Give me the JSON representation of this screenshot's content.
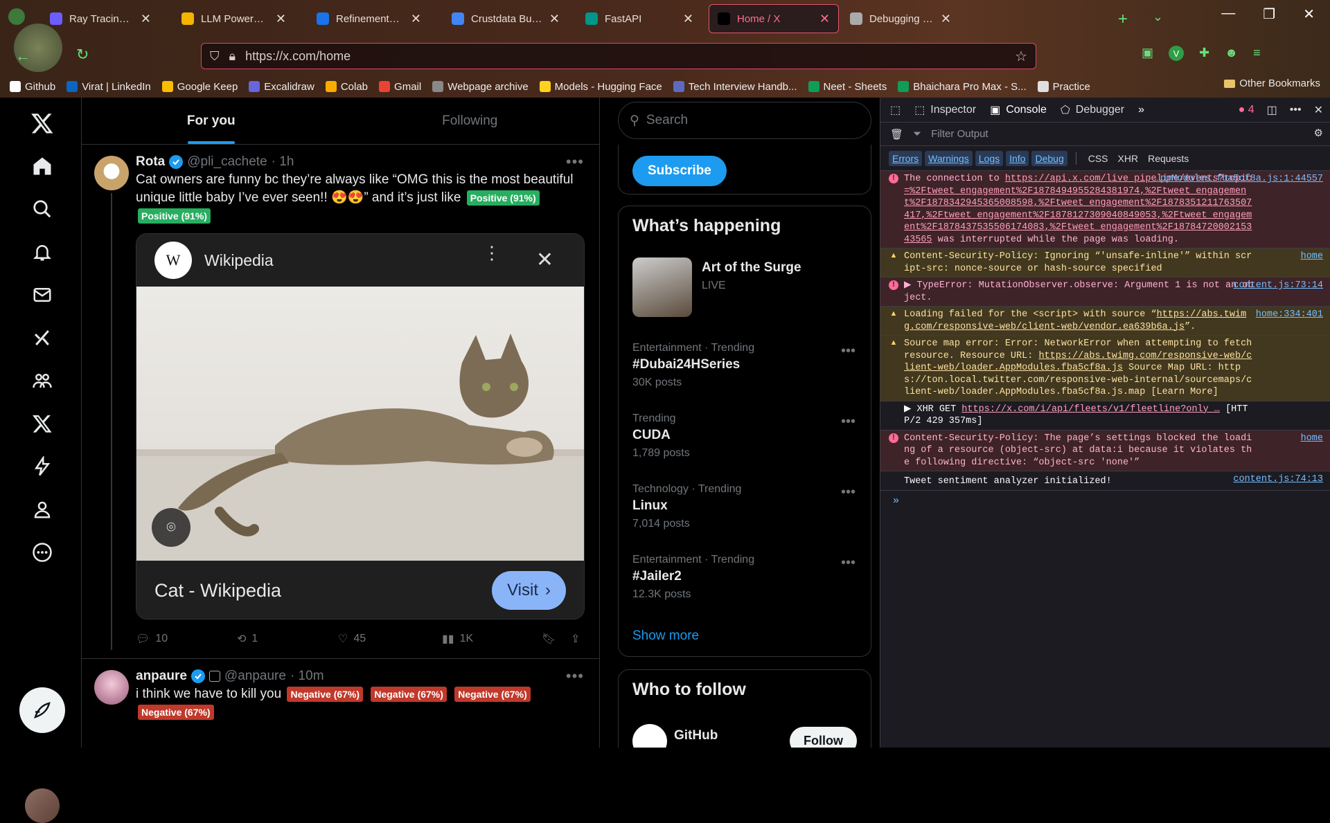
{
  "browser": {
    "tabs": [
      {
        "title": "Ray Tracing in One",
        "color": "#6d5dfc"
      },
      {
        "title": "LLM Powered Autonom",
        "color": "#f4b400"
      },
      {
        "title": "Refinements to Be",
        "color": "#1a73e8"
      },
      {
        "title": "Crustdata Build Ch",
        "color": "#4285f4"
      },
      {
        "title": "FastAPI",
        "color": "#009688"
      },
      {
        "title": "Home / X",
        "color": "#000000",
        "active": true
      },
      {
        "title": "Debugging - Runt",
        "color": "#aaaaaa"
      }
    ],
    "url": "https://x.com/home",
    "bookmarks": [
      {
        "label": "Github",
        "color": "#ffffff"
      },
      {
        "label": "Virat | LinkedIn",
        "color": "#0a66c2"
      },
      {
        "label": "Google Keep",
        "color": "#fbbc04"
      },
      {
        "label": "Excalidraw",
        "color": "#6965db"
      },
      {
        "label": "Colab",
        "color": "#f9ab00"
      },
      {
        "label": "Gmail",
        "color": "#ea4335"
      },
      {
        "label": "Webpage archive",
        "color": "#888888"
      },
      {
        "label": "Models - Hugging Face",
        "color": "#ffd21e"
      },
      {
        "label": "Tech Interview Handb...",
        "color": "#5c6bc0"
      },
      {
        "label": "Neet - Sheets",
        "color": "#0f9d58"
      },
      {
        "label": "Bhaichara Pro Max - S...",
        "color": "#0f9d58"
      },
      {
        "label": "Practice",
        "color": "#e0e0e0"
      }
    ],
    "other_bookmarks": "Other Bookmarks"
  },
  "feed": {
    "tabs": [
      "For you",
      "Following"
    ],
    "post1": {
      "name": "Rota",
      "handle": "@pli_cachete",
      "time": "· 1h",
      "text": "Cat owners are funny bc they’re always like “OMG this is the most beautiful unique little baby I’ve ever seen!! 😍😍” and it’s just like",
      "tags": [
        "Positive (91%)",
        "Positive (91%)"
      ],
      "card": {
        "site": "Wikipedia",
        "logo": "W",
        "title": "Cat - Wikipedia",
        "button": "Visit"
      },
      "stats": {
        "replies": "10",
        "reposts": "1",
        "likes": "45",
        "views": "1K"
      }
    },
    "post2": {
      "name": "anpaure",
      "handle": "@anpaure",
      "time": "· 10m",
      "text": "i think we have to kill you",
      "tags": [
        "Negative (67%)",
        "Negative (67%)",
        "Negative (67%)",
        "Negative (67%)"
      ]
    }
  },
  "sidebar": {
    "search_placeholder": "Search",
    "subscribe": "Subscribe",
    "happening_title": "What’s happening",
    "live": {
      "name": "Art of the Surge",
      "status": "LIVE"
    },
    "trends": [
      {
        "meta": "Entertainment · Trending",
        "name": "#Dubai24HSeries",
        "posts": "30K posts"
      },
      {
        "meta": "Trending",
        "name": "CUDA",
        "posts": "1,789 posts"
      },
      {
        "meta": "Technology · Trending",
        "name": "Linux",
        "posts": "7,014 posts"
      },
      {
        "meta": "Entertainment · Trending",
        "name": "#Jailer2",
        "posts": "12.3K posts"
      }
    ],
    "show_more": "Show more",
    "who_title": "Who to follow",
    "suggest": {
      "name": "GitHub",
      "follow": "Follow"
    }
  },
  "devtools": {
    "tabs": {
      "inspector": "Inspector",
      "console": "Console",
      "debugger": "Debugger"
    },
    "error_count": "4",
    "filter_placeholder": "Filter Output",
    "levels": [
      "Errors",
      "Warnings",
      "Logs",
      "Info",
      "Debug"
    ],
    "extra_levels": [
      "CSS",
      "XHR",
      "Requests"
    ],
    "logs": [
      {
        "type": "err",
        "pre": "The connection to ",
        "link": "https://api.x.com/live_pipeline/events?topic=%2Ftweet_engagement%2F1878494955284381974,%2Ftweet_engagement%2F1878342945365008598,%2Ftweet_engagement%2F1878351211763507417,%2Ftweet_engagement%2F1878127309040849053,%2Ftweet_engagement%2F1878437535506174083,%2Ftweet_engagement%2F1878472000215343565",
        "post": " was interrupted while the page was loading.",
        "src": "…ppModules.fba5cf8a.js:1:44557"
      },
      {
        "type": "warn",
        "pre": "Content-Security-Policy: Ignoring “'unsafe-inline'” within script-src: nonce-source or hash-source specified",
        "link": "",
        "post": "",
        "src": "home"
      },
      {
        "type": "err",
        "pre": "▶ TypeError: MutationObserver.observe: Argument 1 is not an object.",
        "link": "",
        "post": "",
        "src": "content.js:73:14"
      },
      {
        "type": "warn",
        "pre": "Loading failed for the <script> with source “",
        "link": "https://abs.twimg.com/responsive-web/client-web/vendor.ea639b6a.js",
        "post": "”.",
        "src": "home:334:401"
      },
      {
        "type": "warn",
        "pre": "Source map error: Error: NetworkError when attempting to fetch resource. Resource URL: ",
        "link": "https://abs.twimg.com/responsive-web/client-web/loader.AppModules.fba5cf8a.js",
        "post": " Source Map URL: https://ton.local.twitter.com/responsive-web-internal/sourcemaps/client-web/loader.AppModules.fba5cf8a.js.map [Learn More]",
        "src": ""
      },
      {
        "type": "plain",
        "pre": "▶ XHR GET ",
        "link": "https://x.com/i/api/fleets/v1/fleetline?only …",
        "post": " [HTTP/2 429 357ms]",
        "src": ""
      },
      {
        "type": "err",
        "pre": "Content-Security-Policy: The page’s settings blocked the loading of a resource (object-src) at data:i because it violates the following directive: “object-src 'none'”",
        "link": "",
        "post": "",
        "src": "home"
      },
      {
        "type": "plain",
        "pre": "Tweet sentiment analyzer initialized!",
        "link": "",
        "post": "",
        "src": "content.js:74:13"
      }
    ],
    "prompt": "»"
  }
}
